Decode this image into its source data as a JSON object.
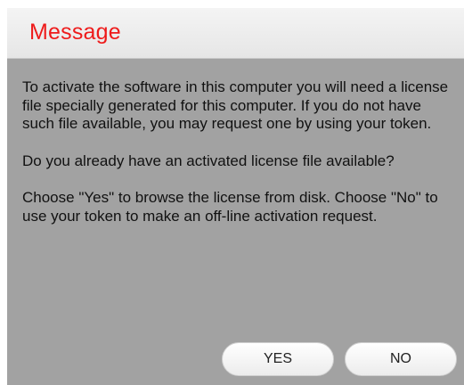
{
  "dialog": {
    "title": "Message",
    "paragraphs": [
      "To activate the software in this computer you will need a license file specially generated for this computer. If you do not have such file available, you may request one by using your token.",
      "Do you already have an activated license file available?",
      "Choose \"Yes\" to browse the license from disk. Choose \"No\" to use your token to make an off-line activation request."
    ],
    "buttons": {
      "yes_label": "YES",
      "no_label": "NO"
    }
  },
  "colors": {
    "title": "#ee1b1b",
    "background": "#a2a2a2",
    "title_bar": "#ebebeb"
  }
}
